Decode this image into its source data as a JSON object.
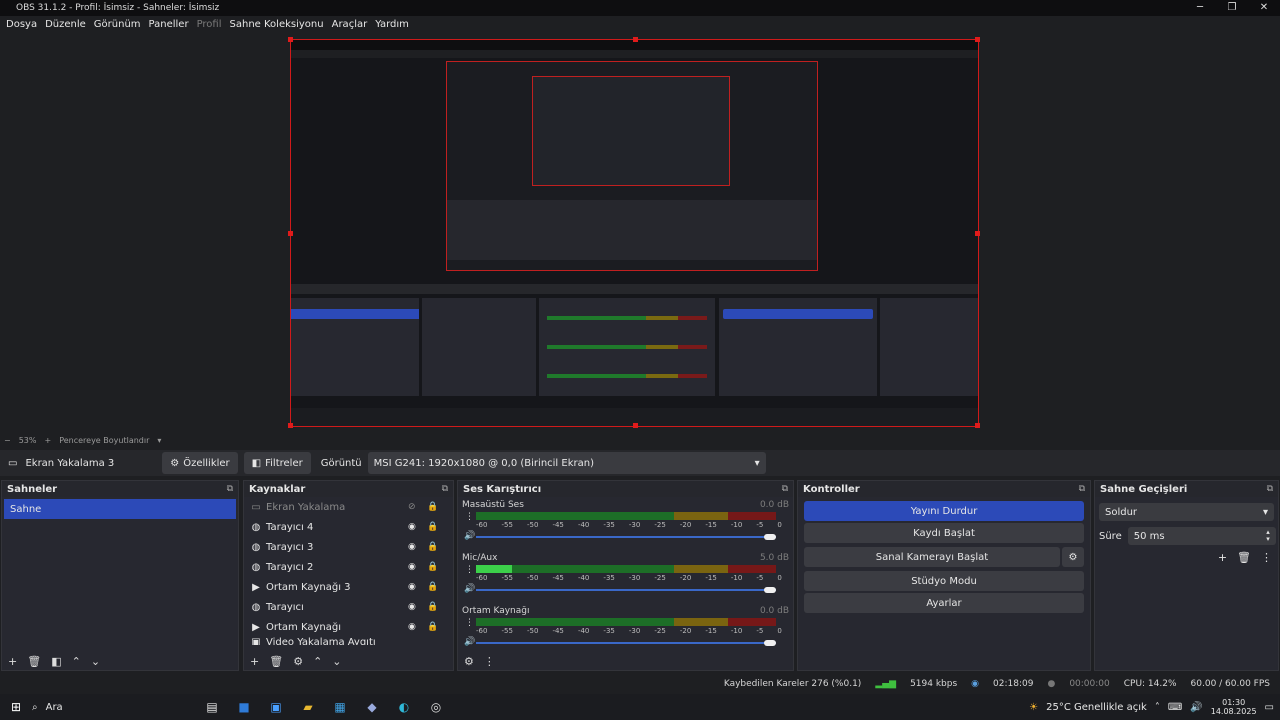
{
  "window": {
    "title": "OBS 31.1.2 - Profil: İsimsiz - Sahneler: İsimsiz"
  },
  "menu": [
    "Dosya",
    "Düzenle",
    "Görünüm",
    "Paneller",
    "Profil",
    "Sahne Koleksiyonu",
    "Araçlar",
    "Yardım"
  ],
  "preview": {
    "zoom": "53%",
    "fit_label": "Pencereye Boyutlandır"
  },
  "source_toolbar": {
    "source_name": "Ekran Yakalama 3",
    "properties": "Özellikler",
    "filters": "Filtreler",
    "display_label": "Görüntü",
    "display_value": "MSI G241: 1920x1080 @ 0,0 (Birincil Ekran)"
  },
  "scenes": {
    "title": "Sahneler",
    "items": [
      "Sahne"
    ]
  },
  "sources": {
    "title": "Kaynaklar",
    "items": [
      "Ekran Yakalama",
      "Tarayıcı 4",
      "Tarayıcı 3",
      "Tarayıcı 2",
      "Ortam Kaynağı 3",
      "Tarayıcı",
      "Ortam Kaynağı",
      "Video Yakalama Aygıtı"
    ]
  },
  "mixer": {
    "title": "Ses Karıştırıcı",
    "channels": [
      {
        "name": "Masaüstü Ses",
        "db": "0.0 dB",
        "level": 0.0,
        "volume": 1.0
      },
      {
        "name": "Mic/Aux",
        "db": "5.0 dB",
        "level": 0.12,
        "volume": 1.0
      },
      {
        "name": "Ortam Kaynağı",
        "db": "0.0 dB",
        "level": 0.0,
        "volume": 1.0
      }
    ],
    "ticks": [
      "-60",
      "-55",
      "-50",
      "-45",
      "-40",
      "-35",
      "-30",
      "-25",
      "-20",
      "-15",
      "-10",
      "-5",
      "0"
    ]
  },
  "controls": {
    "title": "Kontroller",
    "stop_stream": "Yayını Durdur",
    "start_record": "Kaydı Başlat",
    "virtual_cam": "Sanal Kamerayı Başlat",
    "studio_mode": "Stüdyo Modu",
    "settings": "Ayarlar"
  },
  "transitions": {
    "title": "Sahne Geçişleri",
    "type": "Soldur",
    "duration_label": "Süre",
    "duration_value": "50 ms"
  },
  "status": {
    "dropped": "Kaybedilen Kareler 276 (%0.1)",
    "bitrate": "5194 kbps",
    "stream_time": "02:18:09",
    "rec_time": "00:00:00",
    "cpu": "CPU: 14.2%",
    "fps": "60.00 / 60.00 FPS"
  },
  "taskbar": {
    "search": "Ara",
    "weather": "25°C  Genellikle açık",
    "time": "01:30",
    "date": "14.08.2025"
  },
  "colors": {
    "accent": "#2c4ab8",
    "preview_border": "#d01a1a"
  }
}
